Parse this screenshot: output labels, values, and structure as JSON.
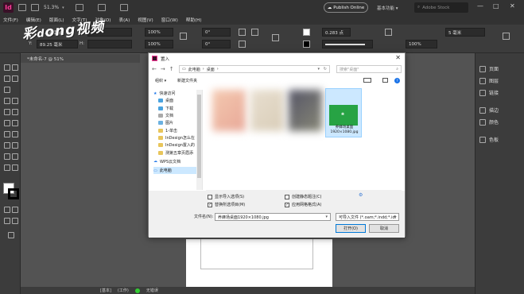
{
  "titlebar": {
    "app_logo": "Id",
    "zoom": "51.3%",
    "publish": "Publish Online",
    "workspace": "基本功能",
    "stock_search": "Adobe Stock"
  },
  "menu": [
    "文件(F)",
    "编辑(E)",
    "版面(L)",
    "文字(T)",
    "对象(O)",
    "表(A)",
    "视图(V)",
    "窗口(W)",
    "帮助(H)"
  ],
  "controlbar": {
    "x_label": "X:",
    "x_value": "54.75 毫米",
    "y_label": "Y:",
    "y_value": "89.25 毫米",
    "w_label": "W:",
    "h_label": "H:",
    "scale1": "100%",
    "scale2": "100%",
    "angle1": "0°",
    "angle2": "0°",
    "stroke": "0.283 点",
    "pct": "100%",
    "mm": "5 毫米"
  },
  "watermark": "彩视频",
  "document_tab": "*未命名-7 @ 51%",
  "right_panel": [
    "页面",
    "图层",
    "链接",
    "描边",
    "颜色",
    "色板"
  ],
  "status": {
    "page": "[基本]",
    "status": "(工作)",
    "errors": "无错误"
  },
  "dialog": {
    "title": "置入",
    "path": [
      "此电脑",
      "桌面"
    ],
    "search_placeholder": "搜索\"桌面\"",
    "organize": "组织 ▾",
    "new_folder": "新建文件夹",
    "nav": [
      {
        "label": "快速访问",
        "type": "star"
      },
      {
        "label": "桌面",
        "type": "folder",
        "pin": true
      },
      {
        "label": "下载",
        "type": "folder",
        "pin": true
      },
      {
        "label": "文档",
        "type": "folder",
        "pin": true
      },
      {
        "label": "图片",
        "type": "folder",
        "pin": true
      },
      {
        "label": "1-单击",
        "type": "folder"
      },
      {
        "label": "InDesign怎么在",
        "type": "folder"
      },
      {
        "label": "InDesign置入的",
        "type": "folder"
      },
      {
        "label": "测第五章页眉添",
        "type": "folder"
      },
      {
        "label": "WPS云文档",
        "type": "cloud"
      },
      {
        "label": "此电脑",
        "type": "pc"
      }
    ],
    "selected_file": {
      "name": "养蜂场桌面",
      "dims": "1920×1080.jpg"
    },
    "options": {
      "show_import_options": "显示导入选项(S)",
      "replace_selected": "替换所选项目(M)",
      "create_static_caption": "创建静态题注(C)",
      "apply_grid_format": "应用网格格式(A)"
    },
    "filename_label": "文件名(N):",
    "filename": "养蜂场桌面1920×1080.jpg",
    "filetype": "可导入文件 (*.oam;*.indd;*.idr",
    "open": "打开(O)",
    "cancel": "取消"
  }
}
